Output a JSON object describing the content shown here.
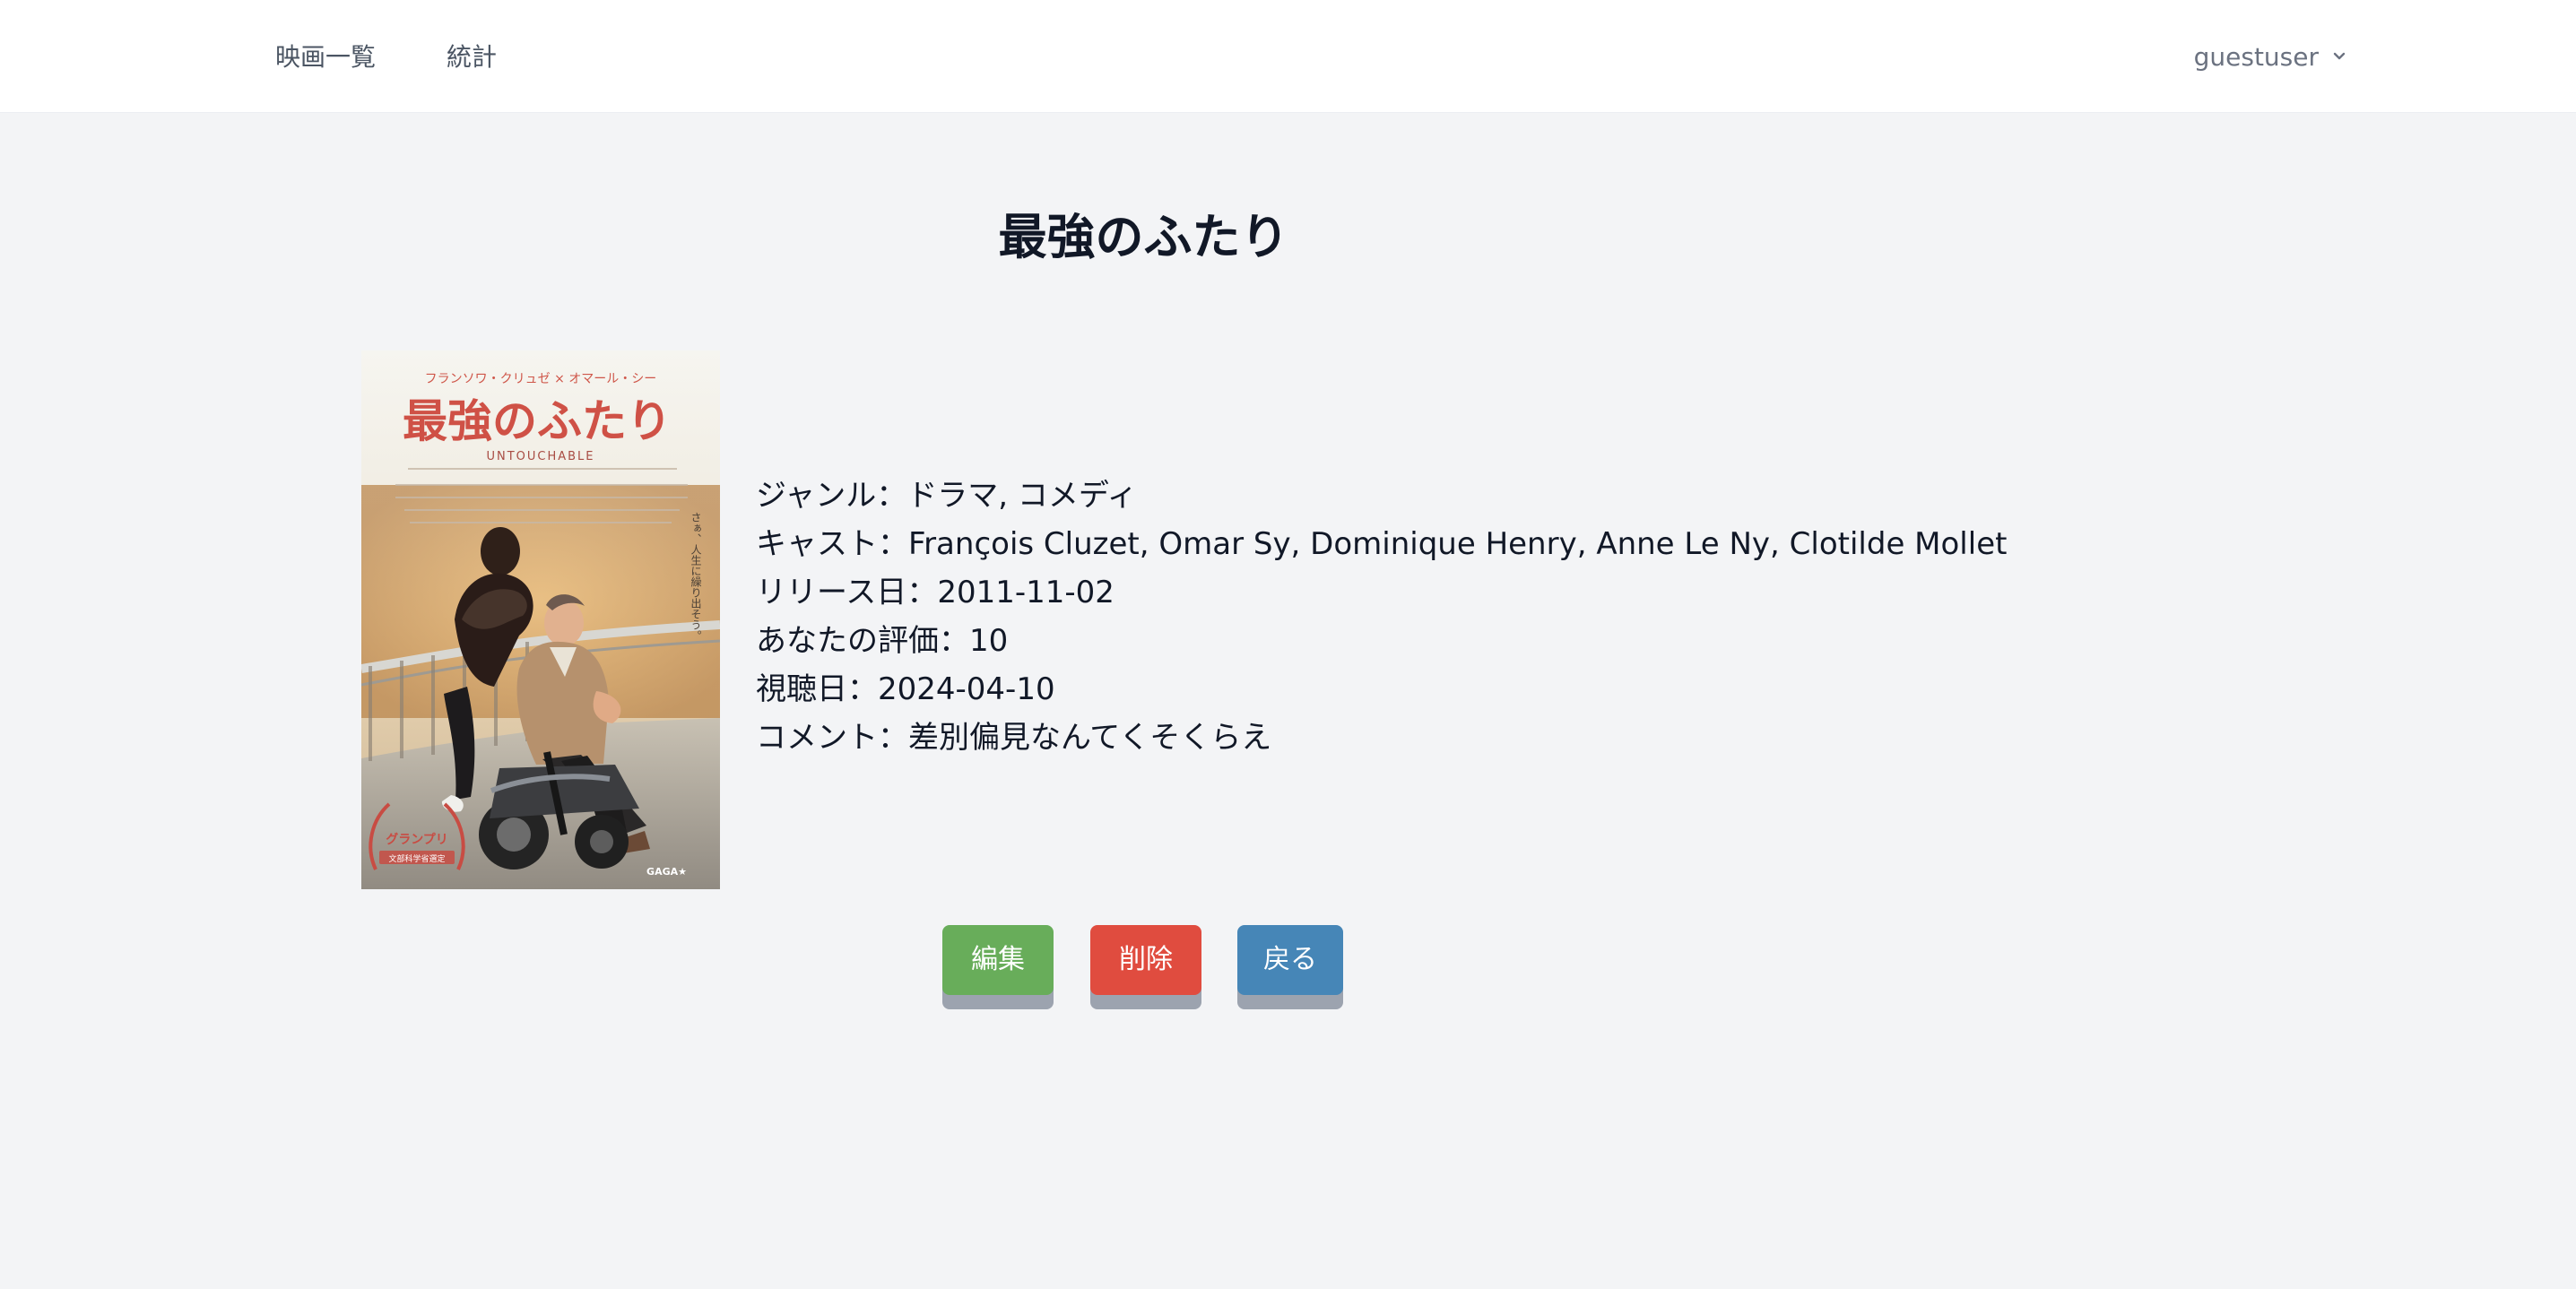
{
  "nav": {
    "movies_label": "映画一覧",
    "stats_label": "統計",
    "user_label": "guestuser",
    "user_icon": "chevron-down-icon"
  },
  "movie": {
    "title": "最強のふたり",
    "poster": {
      "top_caption": "フランソワ・クリュゼ × オマール・シー",
      "title": "最強のふたり",
      "subtitle": "UNTOUCHABLE",
      "side_copy": "さぁ、人生に繰り出そう。",
      "award": "グランプリ",
      "award_detail": "文部科学省選定",
      "distributor": "GAGA★"
    },
    "details": [
      {
        "label": "ジャンル",
        "value": "ドラマ, コメディ"
      },
      {
        "label": "キャスト",
        "value": "François Cluzet, Omar Sy, Dominique Henry, Anne Le Ny, Clotilde Mollet"
      },
      {
        "label": "リリース日",
        "value": "2011-11-02"
      },
      {
        "label": "あなたの評価",
        "value": "10"
      },
      {
        "label": "視聴日",
        "value": "2024-04-10"
      },
      {
        "label": "コメント",
        "value": "差別偏見なんてくそくらえ"
      }
    ]
  },
  "actions": {
    "edit_label": "編集",
    "delete_label": "削除",
    "back_label": "戻る"
  },
  "colors": {
    "background": "#f3f4f6",
    "nav_background": "#ffffff",
    "edit": "#68ad5a",
    "delete": "#e04c3f",
    "back": "#4686b7"
  }
}
